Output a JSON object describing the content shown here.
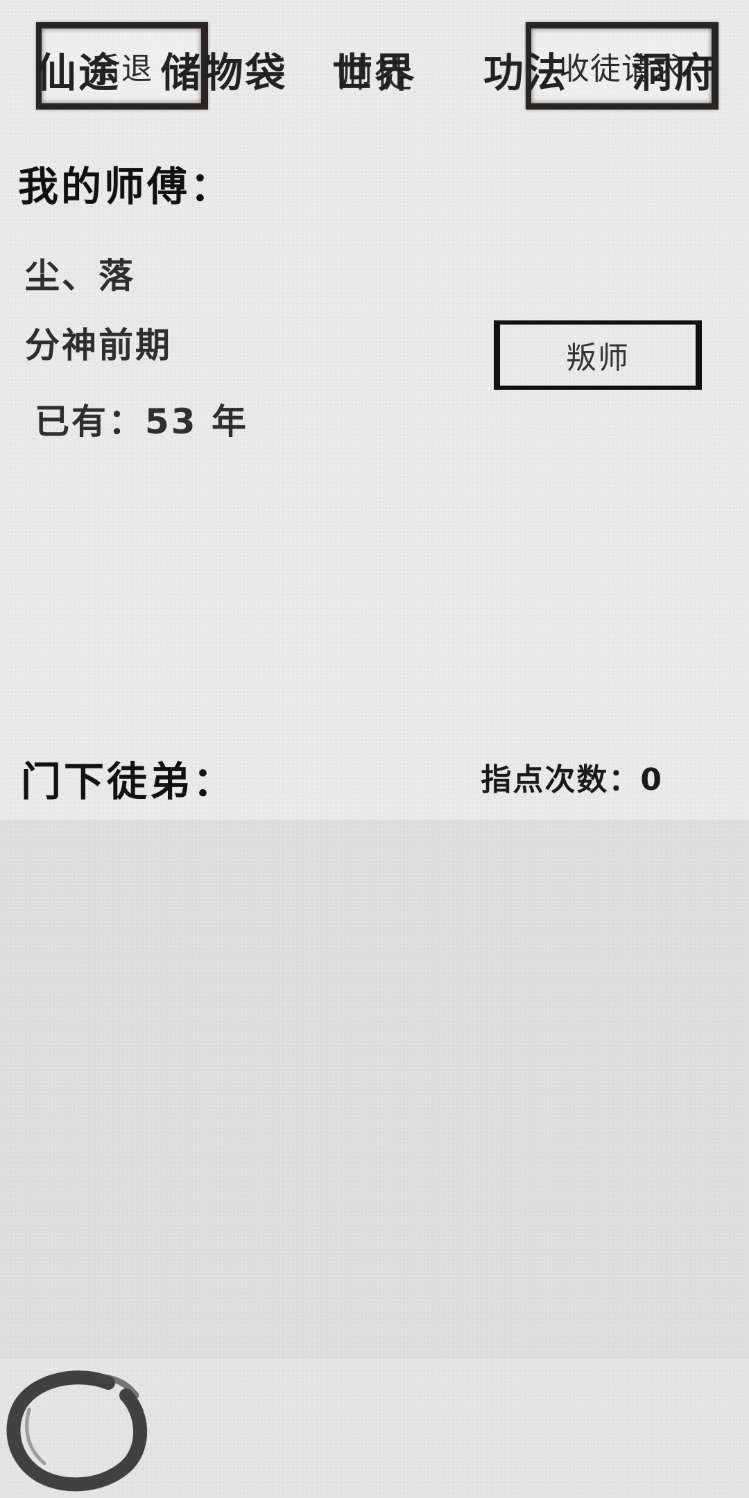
{
  "header": {
    "back_label": "后退",
    "title": "师徒",
    "requests_label": "收徒请求"
  },
  "master": {
    "heading": "我的师傅：",
    "name": "尘、落",
    "realm": "分神前期",
    "years_text": "已有：53 年",
    "betray_label": "叛师"
  },
  "disciples": {
    "heading": "门下徒弟：",
    "guidance_label": "指点次数：",
    "guidance_count": "0",
    "items": []
  },
  "bottom_nav": {
    "items": [
      {
        "label": "仙途",
        "active": true
      },
      {
        "label": "储物袋"
      },
      {
        "label": "世界"
      },
      {
        "label": "功法"
      },
      {
        "label": "洞府"
      }
    ]
  },
  "icons": {
    "active_tab_marker": "ink-circle-icon"
  }
}
